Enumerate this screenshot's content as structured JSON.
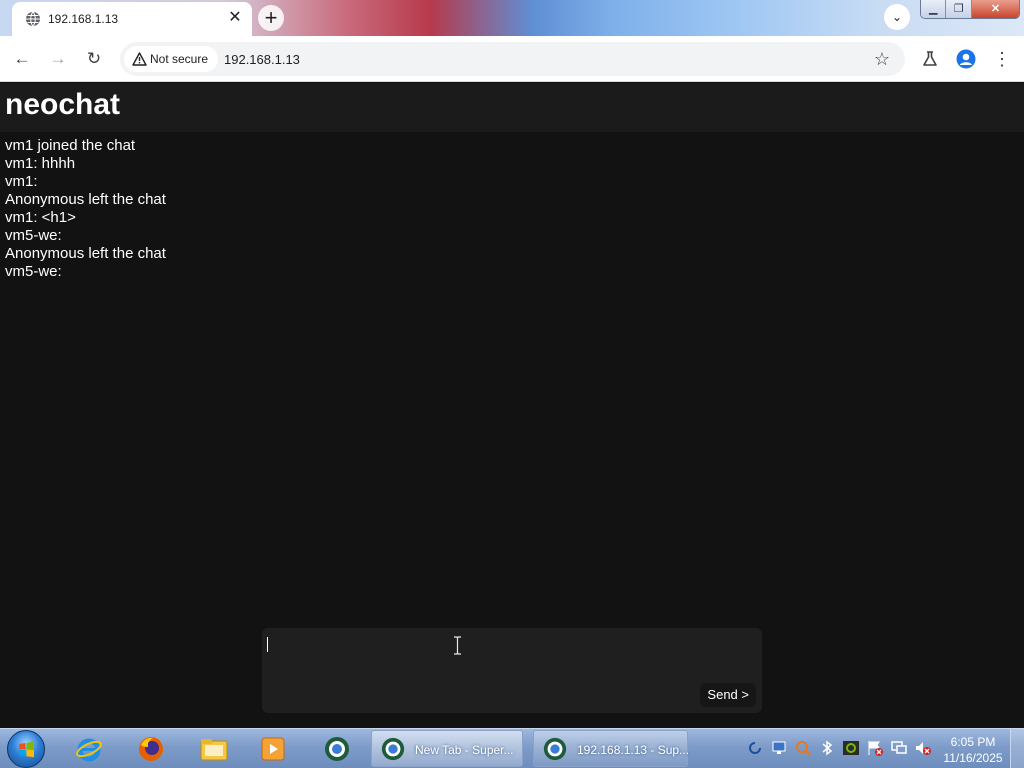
{
  "browser": {
    "tab": {
      "title": "192.168.1.13",
      "icon": "globe-icon",
      "close_icon": "close-icon"
    },
    "new_tab_icon": "plus-icon",
    "tab_search_icon": "chevron-down-icon",
    "window_controls": {
      "minimize": "minimize-icon",
      "maximize": "maximize-icon",
      "close": "close-icon"
    },
    "nav": {
      "back": "back-arrow-icon",
      "forward": "forward-arrow-icon",
      "reload": "reload-icon"
    },
    "address_bar": {
      "security_label": "Not secure",
      "security_icon": "warning-triangle-icon",
      "url": "192.168.1.13"
    },
    "toolbar_icons": [
      "star-icon",
      "labs-flask-icon",
      "profile-icon",
      "more-menu-icon"
    ]
  },
  "page": {
    "title": "neochat",
    "messages": [
      "vm1 joined the chat",
      "vm1: hhhh",
      "vm1: ",
      "Anonymous left the chat",
      "vm1: <h1>",
      "vm5-we: ",
      "Anonymous left the chat",
      "vm5-we: "
    ],
    "composer": {
      "value": "",
      "send_label": "Send >"
    }
  },
  "taskbar": {
    "pinned": [
      "internet-explorer-icon",
      "firefox-icon",
      "file-explorer-icon",
      "media-player-icon",
      "browser-icon"
    ],
    "tasks": [
      {
        "label": "New Tab - Super...",
        "icon": "browser-icon"
      },
      {
        "label": "192.168.1.13 - Sup...",
        "icon": "browser-icon"
      }
    ],
    "tray_icons": [
      "sync-icon",
      "network-manager-icon",
      "search-tool-icon",
      "bluetooth-icon",
      "nvidia-icon",
      "flag-alert-icon",
      "network-icon",
      "volume-muted-icon"
    ],
    "clock": {
      "time": "6:05 PM",
      "date": "11/16/2025"
    }
  },
  "colors": {
    "page_bg": "#121212",
    "header_bg": "#1b1b1b",
    "composer_bg": "#1f1f1f",
    "text": "#ffffff"
  }
}
